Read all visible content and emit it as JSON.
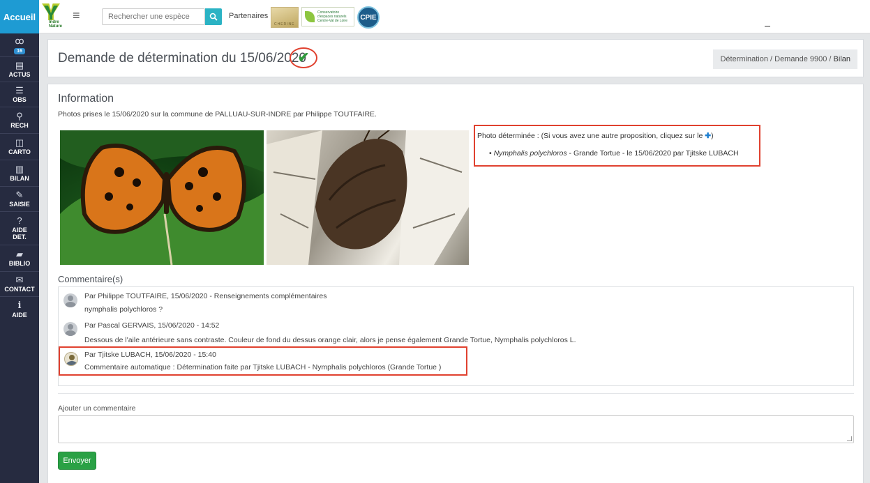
{
  "header": {
    "brand": "Accueil",
    "logo_text_1": "Indre",
    "logo_text_2": "Nature",
    "search_placeholder": "Rechercher une espèce",
    "partners_label": "Partenaires",
    "partner1_text": "CHERINE",
    "partner2_text_1": "Conservatoire",
    "partner2_text_2": "d'espaces naturels",
    "partner2_text_3": "Centre-Val de Loire",
    "partner3_text": "CPIE"
  },
  "sidebar": {
    "items": [
      {
        "label": "",
        "icon": "binoculars-icon",
        "badge": "16"
      },
      {
        "label": "ACTUS",
        "icon": "document-icon"
      },
      {
        "label": "OBS",
        "icon": "list-icon"
      },
      {
        "label": "RECH",
        "icon": "search-icon"
      },
      {
        "label": "CARTO",
        "icon": "map-icon"
      },
      {
        "label": "BILAN",
        "icon": "bar-chart-icon"
      },
      {
        "label": "SAISIE",
        "icon": "edit-icon"
      },
      {
        "label": "AIDE DET.",
        "icon": "question-icon"
      },
      {
        "label": "BIBLIO",
        "icon": "book-icon"
      },
      {
        "label": "CONTACT",
        "icon": "envelope-icon"
      },
      {
        "label": "AIDE",
        "icon": "info-icon"
      }
    ]
  },
  "page": {
    "title": "Demande de détermination du 15/06/2020",
    "breadcrumb": [
      "Détermination",
      "Demande 9900",
      "Bilan"
    ]
  },
  "information": {
    "title": "Information",
    "text": "Photos prises le 15/06/2020 sur la commune de PALLUAU-SUR-INDRE par Philippe TOUTFAIRE.",
    "determination_header": "Photo déterminée : (Si vous avez une autre proposition, cliquez sur le ",
    "determination_header_end": ")",
    "determination_species": "Nymphalis polychloros",
    "determination_rest": " - Grande Tortue - le 15/06/2020 par Tjitske LUBACH"
  },
  "comments": {
    "title": "Commentaire(s)",
    "items": [
      {
        "head": "Par Philippe TOUTFAIRE, 15/06/2020 - Renseignements complémentaires",
        "body": "nymphalis polychloros ?"
      },
      {
        "head": "Par Pascal GERVAIS, 15/06/2020 - 14:52",
        "body": "Dessous de l'aile antérieure sans contraste. Couleur de fond du dessus orange clair, alors je pense également Grande Tortue, Nymphalis polychloros L."
      },
      {
        "head": "Par Tjitske LUBACH, 15/06/2020 - 15:40",
        "body": "Commentaire automatique : Détermination faite par Tjitske LUBACH - Nymphalis polychloros (Grande Tortue )"
      }
    ]
  },
  "form": {
    "label": "Ajouter un commentaire",
    "submit": "Envoyer"
  },
  "colors": {
    "brand": "#1e9bd3",
    "sidebar": "#262b40",
    "highlight": "#e0412f",
    "success": "#2aa145"
  }
}
